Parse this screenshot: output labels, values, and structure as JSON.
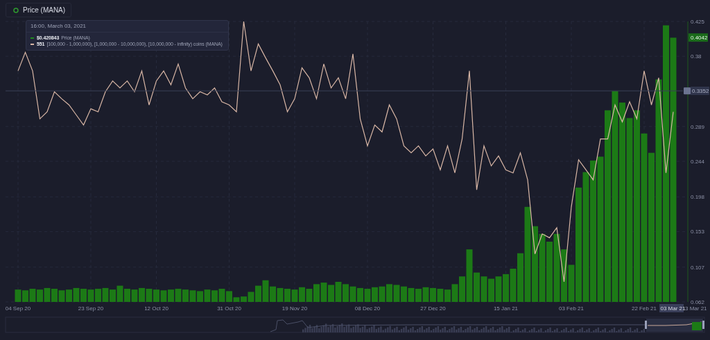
{
  "legend": {
    "label": "Price (MANA)",
    "color": "#2f9a2f"
  },
  "tooltip": {
    "time": "16:00, March 03, 2021",
    "rows": [
      {
        "value": "$0.420843",
        "series": "Price (MANA)",
        "color": "#1f8a1f"
      },
      {
        "value": "551",
        "series": "[100,000 - 1,000,000), [1,000,000 - 10,000,000), [10,000,000 - infinity) coins (MANA)",
        "color": "#d9b7a6"
      }
    ]
  },
  "x_edge_label": "3 Mar 21",
  "chart_data": {
    "type": "bar",
    "grid": true,
    "ylim": [
      0.062,
      0.425
    ],
    "categories": [
      "04 Sep 20",
      null,
      null,
      null,
      null,
      null,
      null,
      null,
      null,
      null,
      "23 Sep 20",
      null,
      null,
      null,
      null,
      null,
      null,
      null,
      null,
      "12 Oct 20",
      null,
      null,
      null,
      null,
      null,
      null,
      null,
      null,
      null,
      "31 Oct 20",
      null,
      null,
      null,
      null,
      null,
      null,
      null,
      null,
      "19 Nov 20",
      null,
      null,
      null,
      null,
      null,
      null,
      null,
      null,
      null,
      "08 Dec 20",
      null,
      null,
      null,
      null,
      null,
      null,
      null,
      null,
      "27 Dec 20",
      null,
      null,
      null,
      null,
      null,
      null,
      null,
      null,
      null,
      "15 Jan 21",
      null,
      null,
      null,
      null,
      null,
      null,
      null,
      null,
      "03 Feb 21",
      null,
      null,
      null,
      null,
      null,
      null,
      null,
      null,
      null,
      "22 Feb 21",
      null,
      null,
      null,
      null
    ],
    "yticks": [
      0.425,
      0.38,
      0.289,
      0.244,
      0.198,
      0.153,
      0.107,
      0.062
    ],
    "series": [
      {
        "type": "bar",
        "color": "#1c7a16",
        "values": [
          0.078,
          0.077,
          0.079,
          0.078,
          0.08,
          0.079,
          0.077,
          0.078,
          0.08,
          0.079,
          0.078,
          0.079,
          0.08,
          0.078,
          0.083,
          0.079,
          0.078,
          0.08,
          0.079,
          0.078,
          0.077,
          0.078,
          0.079,
          0.078,
          0.077,
          0.076,
          0.078,
          0.077,
          0.079,
          0.076,
          0.068,
          0.069,
          0.075,
          0.083,
          0.09,
          0.082,
          0.08,
          0.079,
          0.078,
          0.081,
          0.079,
          0.085,
          0.087,
          0.084,
          0.088,
          0.085,
          0.082,
          0.08,
          0.079,
          0.081,
          0.082,
          0.085,
          0.084,
          0.082,
          0.08,
          0.079,
          0.081,
          0.08,
          0.079,
          0.078,
          0.085,
          0.095,
          0.13,
          0.1,
          0.095,
          0.092,
          0.095,
          0.098,
          0.105,
          0.125,
          0.185,
          0.16,
          0.15,
          0.14,
          0.15,
          0.13,
          0.11,
          0.21,
          0.23,
          0.245,
          0.25,
          0.31,
          0.335,
          0.32,
          0.3,
          0.31,
          0.28,
          0.255,
          0.35,
          0.42,
          0.404
        ]
      },
      {
        "type": "line",
        "color": "#d9b7a6",
        "values": [
          0.361,
          0.385,
          0.361,
          0.299,
          0.308,
          0.334,
          0.325,
          0.317,
          0.304,
          0.291,
          0.312,
          0.308,
          0.334,
          0.348,
          0.339,
          0.348,
          0.334,
          0.361,
          0.317,
          0.348,
          0.361,
          0.343,
          0.37,
          0.339,
          0.325,
          0.334,
          0.33,
          0.339,
          0.321,
          0.317,
          0.308,
          0.425,
          0.361,
          0.396,
          0.378,
          0.361,
          0.343,
          0.308,
          0.325,
          0.365,
          0.352,
          0.325,
          0.37,
          0.339,
          0.352,
          0.325,
          0.383,
          0.299,
          0.264,
          0.291,
          0.282,
          0.317,
          0.299,
          0.264,
          0.255,
          0.264,
          0.251,
          0.26,
          0.233,
          0.264,
          0.229,
          0.273,
          0.361,
          0.207,
          0.264,
          0.238,
          0.251,
          0.233,
          0.229,
          0.255,
          0.22,
          0.124,
          0.15,
          0.145,
          0.158,
          0.088,
          0.185,
          0.246,
          0.233,
          0.22,
          0.273,
          0.273,
          0.317,
          0.295,
          0.321,
          0.299,
          0.361,
          0.317,
          0.352,
          0.229,
          0.308
        ]
      }
    ],
    "ref_lines": [
      {
        "axis": "y",
        "value": 0.3352,
        "label": "0.3352",
        "color": "#3b4058"
      }
    ],
    "annotations": [
      {
        "y": 0.4042,
        "text": "0.4042"
      },
      "03 Mar 21"
    ]
  }
}
